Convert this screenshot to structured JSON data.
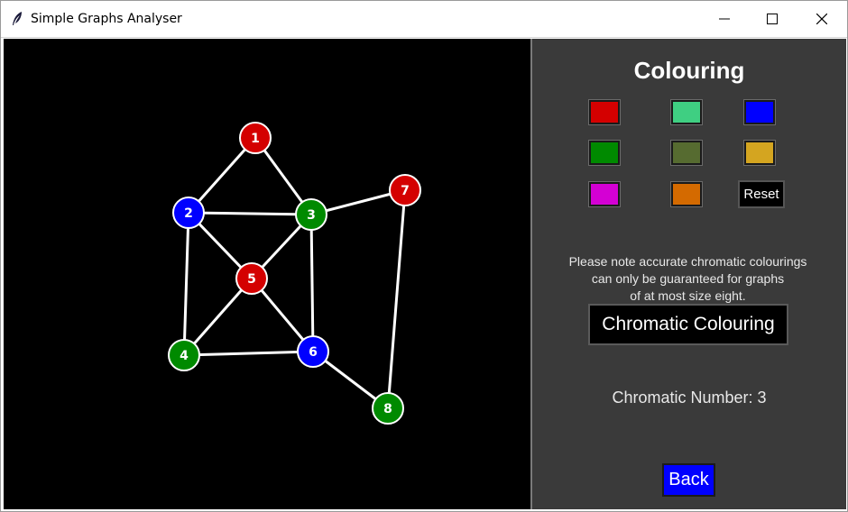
{
  "window": {
    "title": "Simple Graphs Analyser",
    "controls": [
      "minimize-icon",
      "maximize-icon",
      "close-icon"
    ]
  },
  "graph": {
    "nodes": [
      {
        "id": "1",
        "color": "#d40000"
      },
      {
        "id": "2",
        "color": "#0000ff"
      },
      {
        "id": "3",
        "color": "#008a00"
      },
      {
        "id": "4",
        "color": "#008a00"
      },
      {
        "id": "5",
        "color": "#d40000"
      },
      {
        "id": "6",
        "color": "#0000ff"
      },
      {
        "id": "7",
        "color": "#d40000"
      },
      {
        "id": "8",
        "color": "#008a00"
      }
    ],
    "edges": [
      [
        "1",
        "2"
      ],
      [
        "1",
        "3"
      ],
      [
        "2",
        "3"
      ],
      [
        "2",
        "5"
      ],
      [
        "2",
        "4"
      ],
      [
        "3",
        "5"
      ],
      [
        "3",
        "6"
      ],
      [
        "3",
        "7"
      ],
      [
        "4",
        "5"
      ],
      [
        "4",
        "6"
      ],
      [
        "5",
        "6"
      ],
      [
        "6",
        "8"
      ],
      [
        "7",
        "8"
      ]
    ]
  },
  "panel": {
    "title": "Colouring",
    "swatches": [
      "#d40000",
      "#3fcf82",
      "#0000ff",
      "#008a00",
      "#566b30",
      "#d4a520",
      "#d400d4",
      "#d46a00"
    ],
    "reset_label": "Reset",
    "note_lines": [
      "Please note accurate chromatic colourings",
      "can only be guaranteed for graphs",
      "of at most size eight."
    ],
    "chromatic_button_label": "Chromatic Colouring",
    "chromatic_number_text": "Chromatic Number: 3",
    "back_label": "Back"
  }
}
